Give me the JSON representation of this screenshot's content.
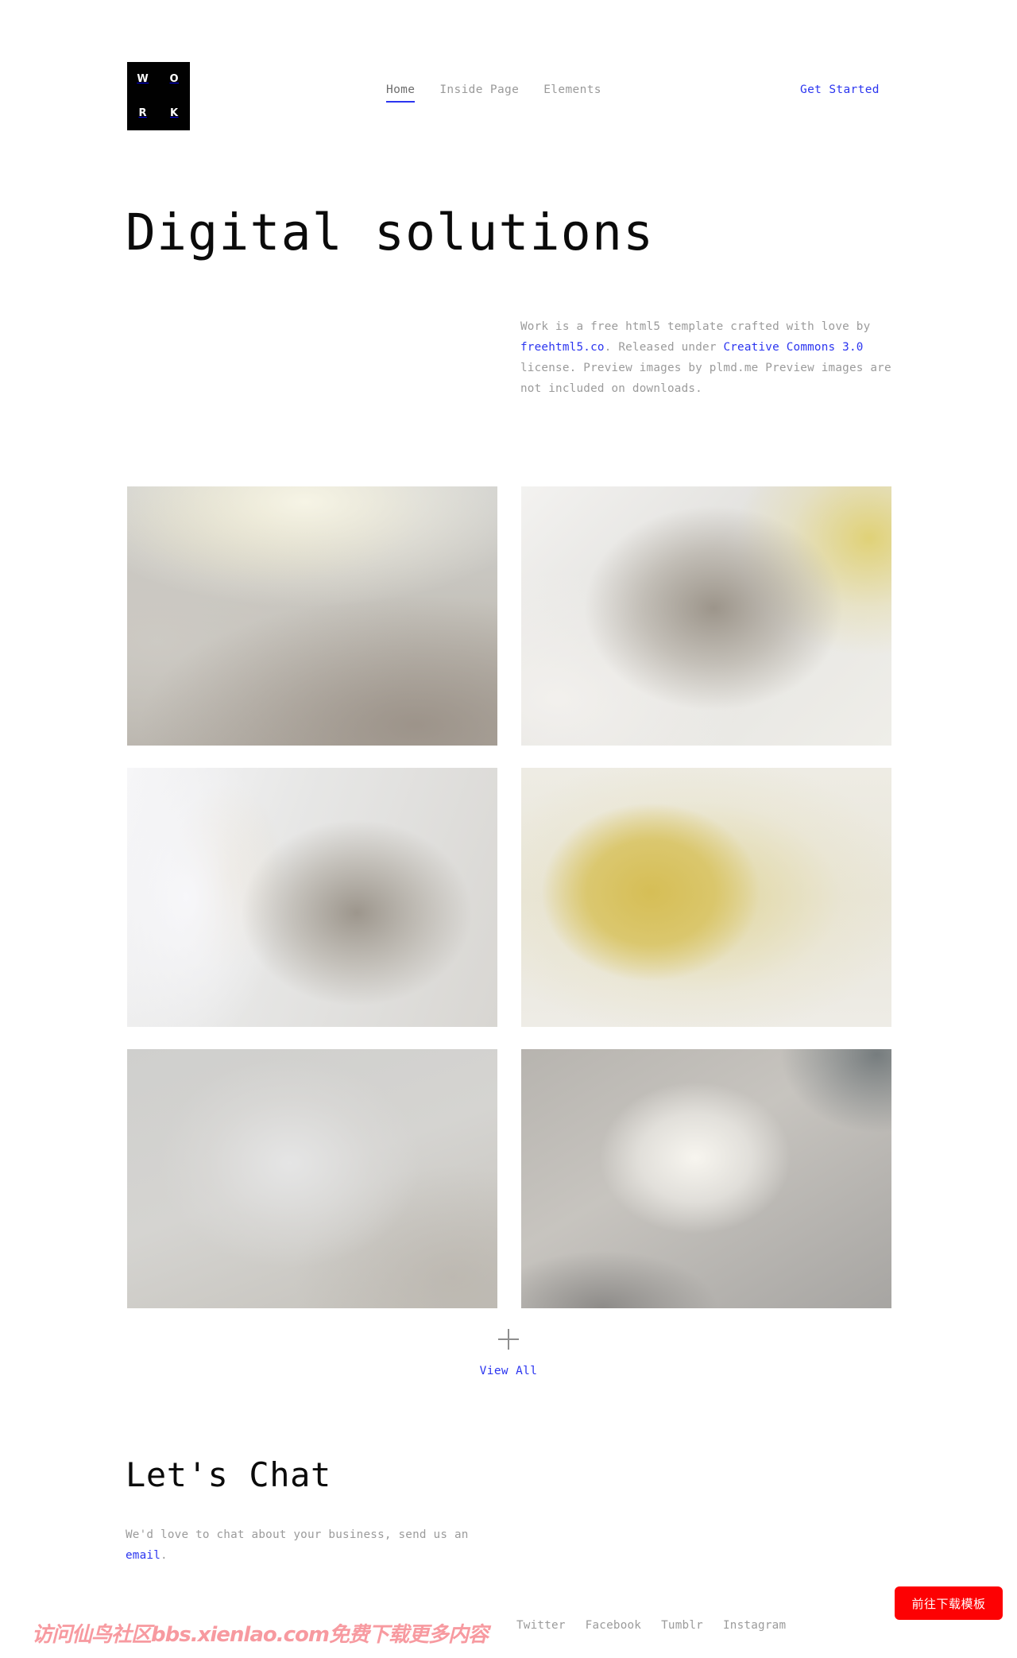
{
  "brand": {
    "logo_letters": [
      "W",
      "O",
      "R",
      "K"
    ],
    "logo_name": "WORK",
    "logo_bg": "#010101"
  },
  "colors": {
    "accent_blue": "#2b35f0",
    "muted_text": "#9b9b9b",
    "heading": "#0b0b0b",
    "cta_red": "#fd0103",
    "watermark_pink": "#f79aa0"
  },
  "nav": {
    "items": [
      {
        "label": "Home",
        "active": true
      },
      {
        "label": "Inside Page",
        "active": false
      },
      {
        "label": "Elements",
        "active": false
      }
    ],
    "cta_label": "Get Started"
  },
  "hero": {
    "title": "Digital solutions",
    "intro": {
      "part1": "Work is a free html5 template crafted with love by ",
      "link1": "freehtml5.co",
      "part2": ". Released under ",
      "link2": "Creative Commons 3.0",
      "part3": " license. Preview images by plmd.me Preview images are not included on downloads."
    }
  },
  "gallery": {
    "tiles": [
      {
        "id": "tile-1",
        "style_class": "t1"
      },
      {
        "id": "tile-2",
        "style_class": "t2"
      },
      {
        "id": "tile-3",
        "style_class": "t3"
      },
      {
        "id": "tile-4",
        "style_class": "t4"
      },
      {
        "id": "tile-5",
        "style_class": "t5"
      },
      {
        "id": "tile-6",
        "style_class": "t6"
      }
    ],
    "view_all_label": "View All",
    "view_all_icon": "plus-icon"
  },
  "chat": {
    "title": "Let's Chat",
    "text_part1": "We'd love to chat about your business, send us an ",
    "email_link": "email",
    "text_part2": "."
  },
  "footer": {
    "social": [
      {
        "label": "Twitter"
      },
      {
        "label": "Facebook"
      },
      {
        "label": "Tumblr"
      },
      {
        "label": "Instagram"
      }
    ]
  },
  "overlay": {
    "cta_button_label": "前往下载模板",
    "watermark_text": "访问仙鸟社区bbs.xienlao.com免费下载更多内容"
  }
}
